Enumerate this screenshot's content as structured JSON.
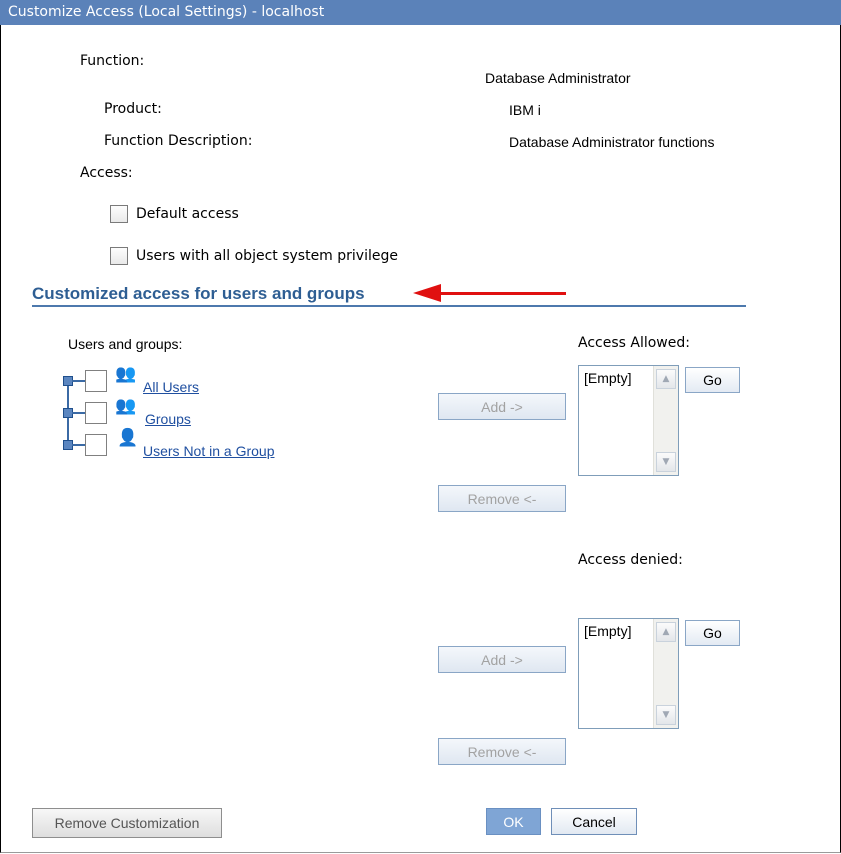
{
  "window": {
    "title": "Customize Access (Local Settings) - localhost"
  },
  "function": {
    "label": "Function:",
    "value": "Database Administrator",
    "product_label": "Product:",
    "product_value": "IBM i",
    "description_label": "Function Description:",
    "description_value": "Database Administrator functions"
  },
  "access": {
    "label": "Access:",
    "options": [
      {
        "label": "Default access",
        "checked": false
      },
      {
        "label": "Users with all object system privilege",
        "checked": false
      }
    ]
  },
  "section": {
    "title": "Customized access for users and groups",
    "arrow_color": "#e01010"
  },
  "tree": {
    "label": "Users and groups:",
    "items": [
      {
        "label": "All Users",
        "icon": "all-users-icon",
        "checked": false
      },
      {
        "label": "Groups",
        "icon": "groups-icon",
        "checked": false
      },
      {
        "label": "Users Not in a Group",
        "icon": "users-not-in-group-icon",
        "checked": false
      }
    ]
  },
  "allowed": {
    "label": "Access Allowed:",
    "list_items": [
      "[Empty]"
    ],
    "go_label": "Go",
    "add_label": "Add ->",
    "remove_label": "Remove <-"
  },
  "denied": {
    "label": "Access denied:",
    "list_items": [
      "[Empty]"
    ],
    "go_label": "Go",
    "add_label": "Add ->",
    "remove_label": "Remove <-"
  },
  "footer": {
    "remove_customization_label": "Remove Customization",
    "ok_label": "OK",
    "cancel_label": "Cancel"
  },
  "colors": {
    "titlebar": "#5b82b9",
    "section_title": "#2e5e93",
    "link": "#1f4fa0",
    "ok_button": "#7fa5d5"
  }
}
